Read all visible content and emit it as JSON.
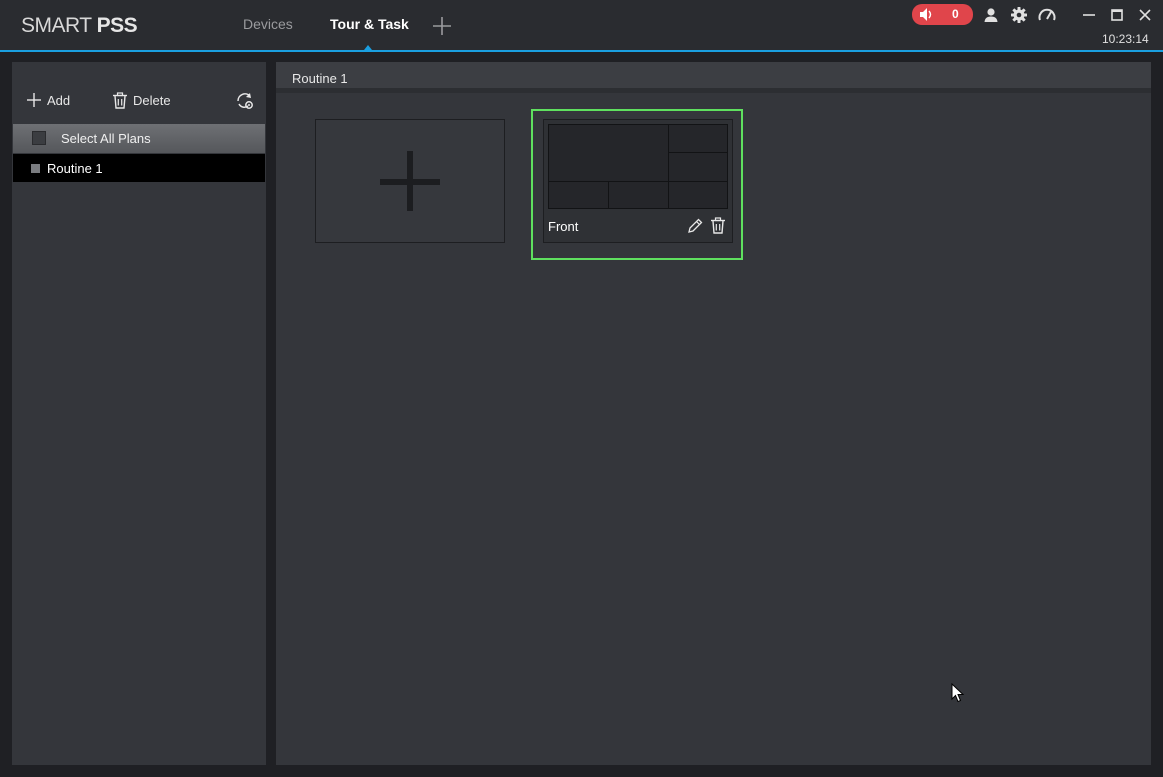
{
  "app": {
    "logo_thin": "SMART ",
    "logo_bold": "PSS"
  },
  "nav": {
    "tabs": [
      {
        "label": "Devices",
        "active": false
      },
      {
        "label": "Tour & Task",
        "active": true
      }
    ],
    "add_tab_icon": "plus-icon"
  },
  "status": {
    "alarm_count": "0",
    "alarm_color": "#e0454b",
    "clock": "10:23:14"
  },
  "window_icons": [
    "user-icon",
    "gear-icon",
    "speedometer-icon",
    "minimize-icon",
    "maximize-icon",
    "close-icon"
  ],
  "sidebar": {
    "add_label": "Add",
    "delete_label": "Delete",
    "select_all_label": "Select All Plans",
    "items": [
      {
        "label": "Routine 1",
        "selected": true
      }
    ]
  },
  "main": {
    "title": "Routine 1",
    "plans": [
      {
        "name": "Front",
        "selected": true
      }
    ]
  },
  "colors": {
    "accent": "#1a9fe0",
    "selection": "#5fe05f"
  }
}
